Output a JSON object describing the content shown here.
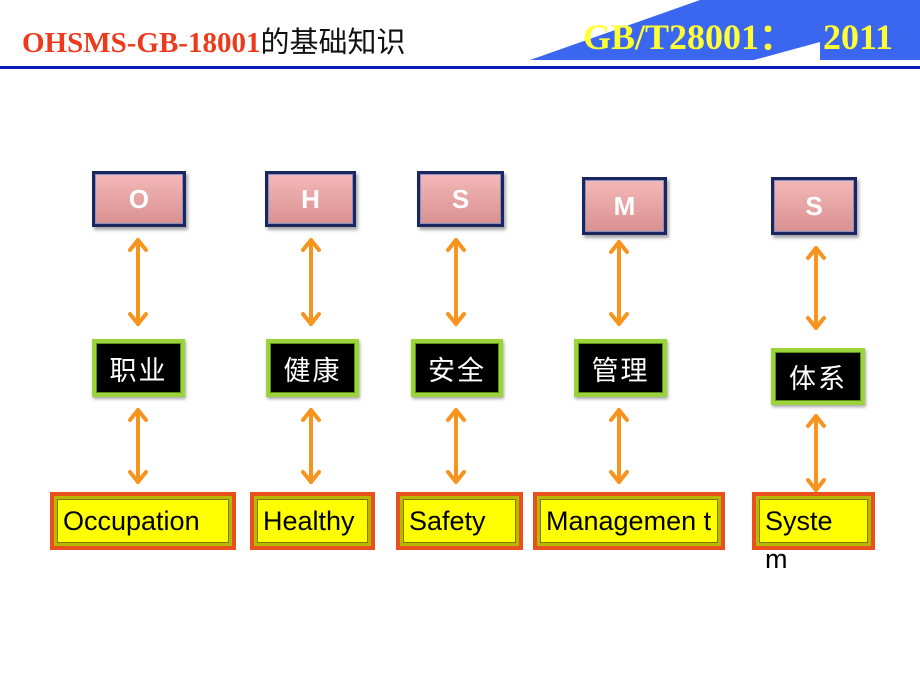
{
  "header": {
    "title_latin": "OHSMS-GB-18001",
    "title_cjk": "的基础知识",
    "standard_code": "GB/T28001：",
    "standard_year": "2011",
    "colors": {
      "title_latin": "#ee3a1c",
      "banner_blue": "#3a66f0",
      "standard_text": "#ffff33",
      "rule": "#0a1db8"
    }
  },
  "diagram": {
    "columns": [
      {
        "letter": "O",
        "chinese": "职业",
        "english": "Occupation"
      },
      {
        "letter": "H",
        "chinese": "健康",
        "english": "Healthy"
      },
      {
        "letter": "S",
        "chinese": "安全",
        "english": "Safety"
      },
      {
        "letter": "M",
        "chinese": "管理",
        "english": "Managemen t"
      },
      {
        "letter": "S",
        "chinese": "体系",
        "english": "Syste m"
      }
    ],
    "connector_icon": "double-headed-vertical-arrow",
    "colors": {
      "letter_box_fill": "#e8a4a4",
      "letter_box_border": "#1b2660",
      "cjk_box_fill": "#000000",
      "cjk_box_border": "#9bd43a",
      "word_box_fill": "#ffff00",
      "word_box_border": "#e8501e",
      "arrow": "#f7941d"
    }
  }
}
